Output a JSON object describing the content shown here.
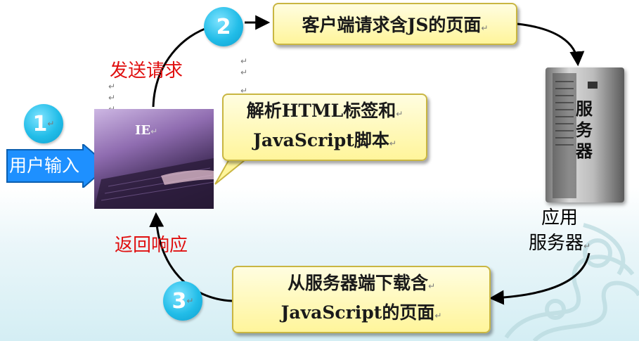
{
  "steps": {
    "step1": "1",
    "step2": "2",
    "step3": "3"
  },
  "user_input_label": "用户输入",
  "send_request_label": "发送请求",
  "return_response_label": "返回响应",
  "browser_label": "IE",
  "request_box_text": "客户端请求含JS的页面",
  "parse_box": {
    "line1": "解析HTML标签和",
    "line2": "JavaScript脚本"
  },
  "download_box": {
    "line1": "从服务器端下载含",
    "line2": "JavaScript的页面"
  },
  "server_text": "服务器",
  "app_server_label": {
    "line1": "应用",
    "line2": "服务器"
  },
  "paragraph_mark": "↵",
  "colors": {
    "step_circle": "#22bde8",
    "box_fill": "#fff59b",
    "box_border": "#c9b642",
    "red_label": "#e01010",
    "input_arrow": "#1e90ff"
  }
}
